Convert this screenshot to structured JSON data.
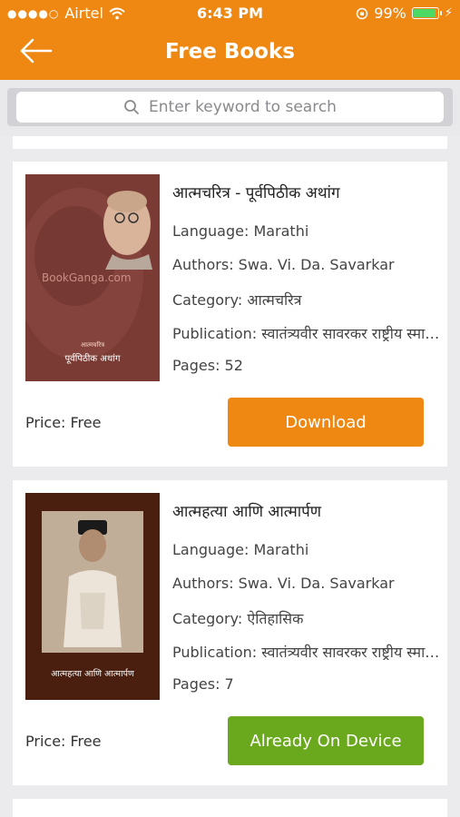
{
  "status_bar": {
    "signal_dots": "●●●●○",
    "carrier": "Airtel",
    "wifi_icon": "wifi-icon",
    "time": "6:43 PM",
    "lock_icon": "orientation-lock-icon",
    "battery_percent": "99%",
    "battery_level": 0.99
  },
  "header": {
    "title": "Free Books",
    "back_icon": "arrow-left-icon"
  },
  "search": {
    "placeholder": "Enter keyword to search",
    "icon": "search-icon"
  },
  "books": [
    {
      "title": "आत्मचरित्र - पूर्वपिठीक अथांग",
      "language": "Language: Marathi",
      "authors": "Authors: Swa. Vi. Da. Savarkar",
      "category": "Category: आत्मचरित्र",
      "publication": "Publication: स्वातंत्र्यवीर सावरकर राष्ट्रीय स्मारक",
      "pages": "Pages: 52",
      "price": "Price: Free",
      "button_label": "Download",
      "cover_watermark": "BookGanga.com",
      "cover_small": "आत्मचरित्र",
      "cover_title": "पूर्वपिठीक अथांग"
    },
    {
      "title": "आत्महत्या आणि आत्मार्पण",
      "language": "Language: Marathi",
      "authors": "Authors: Swa. Vi. Da. Savarkar",
      "category": "Category: ऐतिहासिक",
      "publication": "Publication: स्वातंत्र्यवीर सावरकर राष्ट्रीय स्मारक",
      "pages": "Pages: 7",
      "price": "Price: Free",
      "button_label": "Already On Device",
      "cover_title": "आत्महत्या आणि आत्मार्पण"
    }
  ],
  "colors": {
    "header": "#ef8813",
    "download_button": "#ef8813",
    "device_button": "#6aa81e",
    "background": "#ebebed"
  }
}
